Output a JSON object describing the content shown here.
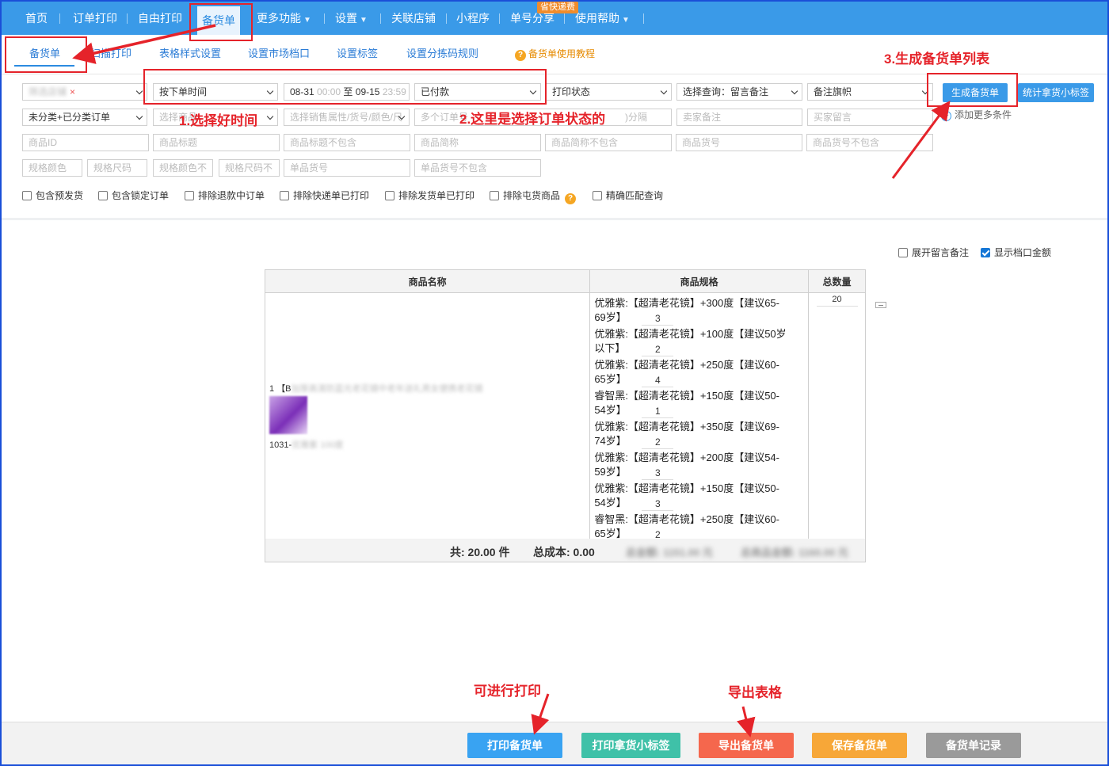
{
  "nav": {
    "items": [
      "首页",
      "订单打印",
      "自由打印",
      "备货单",
      "更多功能",
      "设置",
      "关联店铺",
      "小程序",
      "单号分享",
      "使用帮助"
    ],
    "badge": "省快递费"
  },
  "subtabs": [
    "备货单",
    "扫描打印",
    "表格样式设置",
    "设置市场档口",
    "设置标签",
    "设置分拣码规则"
  ],
  "help_link": "备货单使用教程",
  "filters": {
    "shop": "筛选店铺",
    "time_type": "按下单时间",
    "date_start": "08-31",
    "date_start_time": "00:00",
    "date_sep": "至",
    "date_end": "09-15",
    "date_end_time": "23:59",
    "pay_status": "已付款",
    "print_status": "打印状态",
    "query": "选择查询：留言备注",
    "flag": "备注旗帜",
    "category": "未分类+已分类订单",
    "goods_select": "选择商品",
    "sales_attr": "选择销售属性/货号/颜色/尺",
    "multi_order": "多个订单号",
    "separator_hint": ")分隔",
    "seller_note": "卖家备注",
    "buyer_msg": "买家留言",
    "goods_id": "商品ID",
    "goods_title": "商品标题",
    "title_exclude": "商品标题不包含",
    "short_name": "商品简称",
    "short_exclude": "商品简称不包含",
    "goods_no": "商品货号",
    "goods_no_exclude": "商品货号不包含",
    "spec_color": "规格颜色",
    "spec_size": "规格尺码",
    "spec_color_ex": "规格颜色不",
    "spec_size_ex": "规格尺码不",
    "single_no": "单品货号",
    "single_no_ex": "单品货号不包含"
  },
  "buttons": {
    "generate": "生成备货单",
    "stat_label": "统计拿货小标签",
    "add_more": "添加更多条件"
  },
  "checkboxes": [
    {
      "label": "包含预发货",
      "checked": false
    },
    {
      "label": "包含锁定订单",
      "checked": false
    },
    {
      "label": "排除退款中订单",
      "checked": false
    },
    {
      "label": "排除快递单已打印",
      "checked": false
    },
    {
      "label": "排除发货单已打印",
      "checked": false
    },
    {
      "label": "排除屯货商品",
      "checked": false
    },
    {
      "label": "精确匹配查询",
      "checked": false
    }
  ],
  "view_options": [
    {
      "label": "展开留言备注",
      "checked": false
    },
    {
      "label": "显示档口金额",
      "checked": true
    }
  ],
  "table": {
    "headers": [
      "商品名称",
      "商品规格",
      "总数量"
    ],
    "product": {
      "index": "1",
      "prefix": "【B",
      "title_blur": "加厚高清防蓝光老花镜中老年送礼男女便携老花镜",
      "code": "1031-",
      "code_blur": "优雅紫 100度"
    },
    "specs": [
      {
        "line1": "优雅紫:【超清老花镜】+300度【建议65-",
        "line2": "69岁】",
        "qty": "3"
      },
      {
        "line1": "优雅紫:【超清老花镜】+100度【建议50岁",
        "line2": "以下】",
        "qty": "2"
      },
      {
        "line1": "优雅紫:【超清老花镜】+250度【建议60-",
        "line2": "65岁】",
        "qty": "4"
      },
      {
        "line1": "睿智黑:【超清老花镜】+150度【建议50-",
        "line2": "54岁】",
        "qty": "1"
      },
      {
        "line1": "优雅紫:【超清老花镜】+350度【建议69-",
        "line2": "74岁】",
        "qty": "2"
      },
      {
        "line1": "优雅紫:【超清老花镜】+200度【建议54-",
        "line2": "59岁】",
        "qty": "3"
      },
      {
        "line1": "优雅紫:【超清老花镜】+150度【建议50-",
        "line2": "54岁】",
        "qty": "3"
      },
      {
        "line1": "睿智黑:【超清老花镜】+250度【建议60-",
        "line2": "65岁】",
        "qty": "2"
      }
    ],
    "total_qty": "20",
    "footer_total": "共: 20.00 件",
    "footer_cost": "总成本: 0.00",
    "footer_blur1": "总金额: 1151.00 元",
    "footer_blur2": "总商品金额: 1160.00 元"
  },
  "bottom_buttons": [
    {
      "label": "打印备货单",
      "color": "#39a3f2"
    },
    {
      "label": "打印拿货小标签",
      "color": "#3fc1a8"
    },
    {
      "label": "导出备货单",
      "color": "#f5674d"
    },
    {
      "label": "保存备货单",
      "color": "#f7a738"
    },
    {
      "label": "备货单记录",
      "color": "#9a9a9a"
    }
  ],
  "annotations": {
    "step1": "1.选择好时间",
    "step2": "2.这里是选择订单状态的",
    "step3": "3.生成备货单列表",
    "print_note": "可进行打印",
    "export_note": "导出表格"
  },
  "colors": {
    "nav": "#3a9ae8",
    "annotation": "#e5232a",
    "frame": "#1a4fd8"
  }
}
